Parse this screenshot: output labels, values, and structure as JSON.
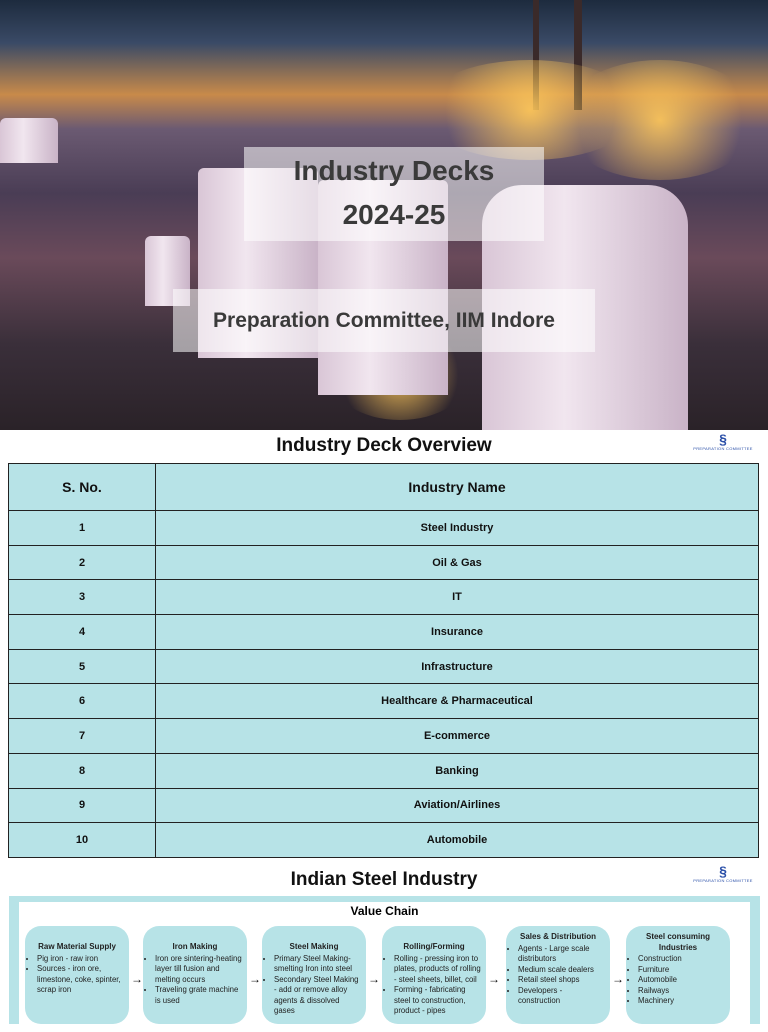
{
  "cover": {
    "title_line1": "Industry Decks",
    "title_line2": "2024-25",
    "subtitle": "Preparation Committee, IIM Indore"
  },
  "overview": {
    "title": "Industry Deck Overview",
    "logo_text": "PREPARATION COMMITTEE",
    "headers": [
      "S. No.",
      "Industry Name"
    ],
    "rows": [
      [
        "1",
        "Steel Industry"
      ],
      [
        "2",
        "Oil & Gas"
      ],
      [
        "3",
        "IT"
      ],
      [
        "4",
        "Insurance"
      ],
      [
        "5",
        "Infrastructure"
      ],
      [
        "6",
        "Healthcare & Pharmaceutical"
      ],
      [
        "7",
        "E-commerce"
      ],
      [
        "8",
        "Banking"
      ],
      [
        "9",
        "Aviation/Airlines"
      ],
      [
        "10",
        "Automobile"
      ]
    ]
  },
  "steel": {
    "title": "Indian Steel Industry",
    "logo_text": "PREPARATION COMMITTEE",
    "chain_title": "Value Chain",
    "stages": [
      {
        "title": "Raw Material Supply",
        "items": [
          "Pig iron - raw iron",
          "Sources - iron ore, limestone, coke, spinter, scrap iron"
        ]
      },
      {
        "title": "Iron Making",
        "items": [
          "Iron ore sintering-heating layer till fusion and melting occurs",
          "Traveling grate machine is used"
        ]
      },
      {
        "title": "Steel Making",
        "items": [
          "Primary Steel Making-smelting Iron into steel",
          "Secondary Steel Making - add or remove alloy agents & dissolved gases"
        ]
      },
      {
        "title": "Rolling/Forming",
        "items": [
          "Rolling - pressing iron to plates, products of rolling - steel sheets, billet, coil",
          "Forming - fabricating steel to construction, product - pipes"
        ]
      },
      {
        "title": "Sales & Distribution",
        "items": [
          "Agents - Large scale distributors",
          "Medium scale dealers",
          "Retail steel shops",
          "Developers - construction"
        ]
      },
      {
        "title": "Steel consuming Industries",
        "items": [
          "Construction",
          "Furniture",
          "Automobile",
          "Railways",
          "Machinery"
        ]
      }
    ]
  }
}
